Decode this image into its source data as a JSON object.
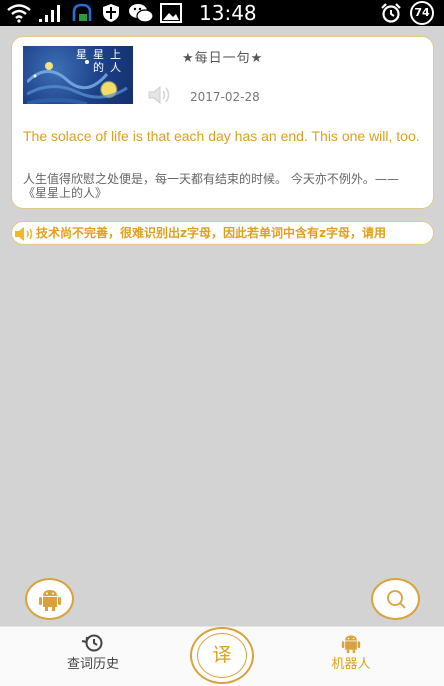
{
  "status_bar": {
    "time": "13:48",
    "battery": "74",
    "icons": [
      "wifi-icon",
      "signal-icon",
      "notification-icon",
      "shield-icon",
      "wechat-icon",
      "image-icon",
      "alarm-icon"
    ]
  },
  "daily": {
    "heading": "★每日一句★",
    "cover_title": "星星上的人",
    "date": "2017-02-28",
    "quote_en": "The solace of life is that each day has an end. This one will, too.",
    "quote_zh": "人生值得欣慰之处便是，每一天都有结束的时候。 今天亦不例外。——《星星上的人》"
  },
  "notice": {
    "text": "技术尚不完善，很难识别出z字母，因此若单词中含有z字母，请用"
  },
  "nav": {
    "history_label": "查词历史",
    "translate_label": "译",
    "robot_label": "机器人"
  },
  "colors": {
    "accent": "#e09f1d",
    "border": "#d9a23a",
    "background": "#d3d3d3"
  }
}
